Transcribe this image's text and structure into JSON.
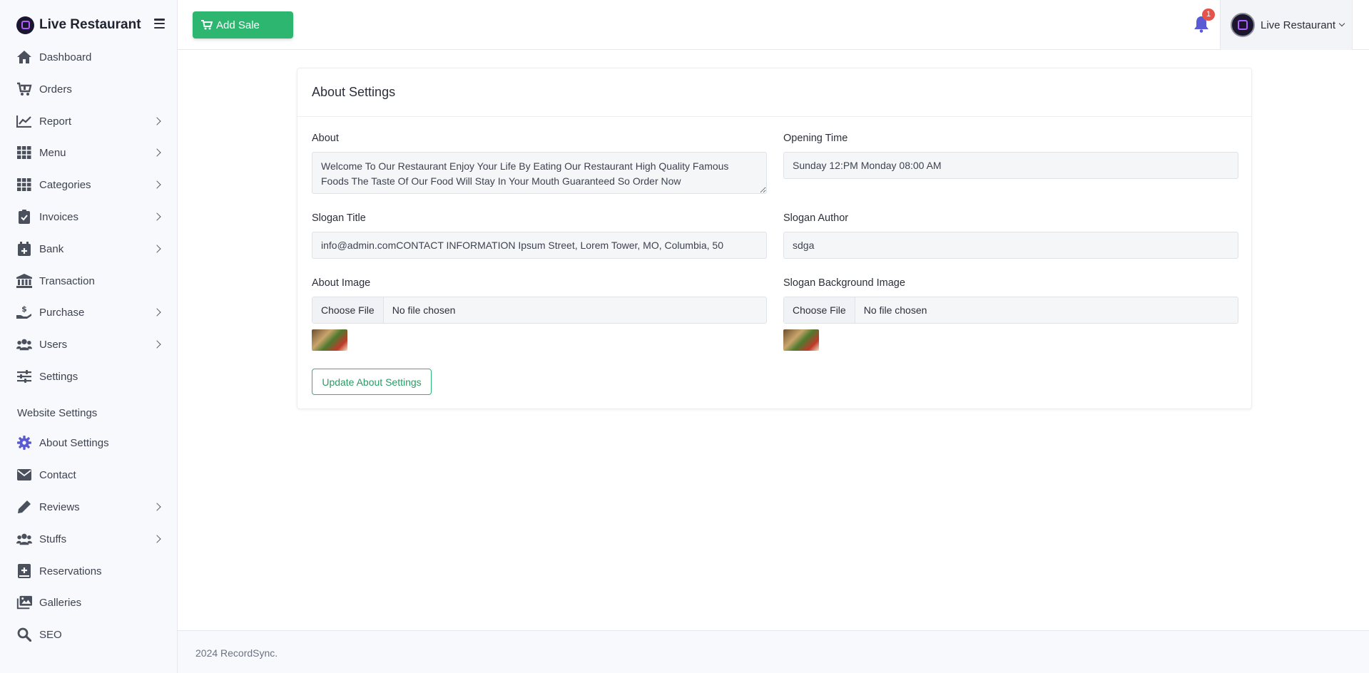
{
  "brand": {
    "name": "Live Restaurant"
  },
  "sidebar": {
    "items": [
      {
        "label": "Dashboard",
        "icon": "home-icon"
      },
      {
        "label": "Orders",
        "icon": "cart-icon"
      },
      {
        "label": "Report",
        "icon": "chart-line-icon"
      },
      {
        "label": "Menu",
        "icon": "grid-icon"
      },
      {
        "label": "Categories",
        "icon": "grid-icon"
      },
      {
        "label": "Invoices",
        "icon": "clipboard-check-icon"
      },
      {
        "label": "Bank",
        "icon": "calendar-plus-icon"
      },
      {
        "label": "Transaction",
        "icon": "bank-icon"
      },
      {
        "label": "Purchase",
        "icon": "hand-dollar-icon"
      },
      {
        "label": "Users",
        "icon": "users-icon"
      },
      {
        "label": "Settings",
        "icon": "sliders-icon"
      }
    ],
    "section_title": "Website Settings",
    "website_items": [
      {
        "label": "About Settings",
        "icon": "gear-icon"
      },
      {
        "label": "Contact",
        "icon": "envelope-icon"
      },
      {
        "label": "Reviews",
        "icon": "pencil-icon"
      },
      {
        "label": "Stuffs",
        "icon": "users-icon"
      },
      {
        "label": "Reservations",
        "icon": "book-plus-icon"
      },
      {
        "label": "Galleries",
        "icon": "images-icon"
      },
      {
        "label": "SEO",
        "icon": "search-icon"
      }
    ]
  },
  "topbar": {
    "add_sale_label": "Add Sale",
    "notification_count": "1",
    "user_name": "Live Restaurant"
  },
  "card": {
    "title": "About Settings",
    "about_label": "About",
    "about_value": "Welcome To Our Restaurant Enjoy Your Life By Eating Our Restaurant High Quality Famous Foods The Taste Of Our Food Will Stay In Your Mouth Guaranteed So Order Now",
    "opening_time_label": "Opening Time",
    "opening_time_value": "Sunday 12:PM  Monday 08:00 AM",
    "slogan_title_label": "Slogan Title",
    "slogan_title_value": "info@admin.comCONTACT INFORMATION Ipsum Street, Lorem Tower, MO, Columbia, 50",
    "slogan_author_label": "Slogan Author",
    "slogan_author_value": "sdga",
    "about_image_label": "About Image",
    "slogan_bg_label": "Slogan Background Image",
    "choose_file": "Choose File",
    "no_file": "No file chosen",
    "update_button": "Update About Settings"
  },
  "footer": {
    "text": "2024 RecordSync."
  },
  "colors": {
    "accent_green": "#2cb66f",
    "active_icon": "#5a5bd4",
    "badge_red": "#e5534b"
  }
}
